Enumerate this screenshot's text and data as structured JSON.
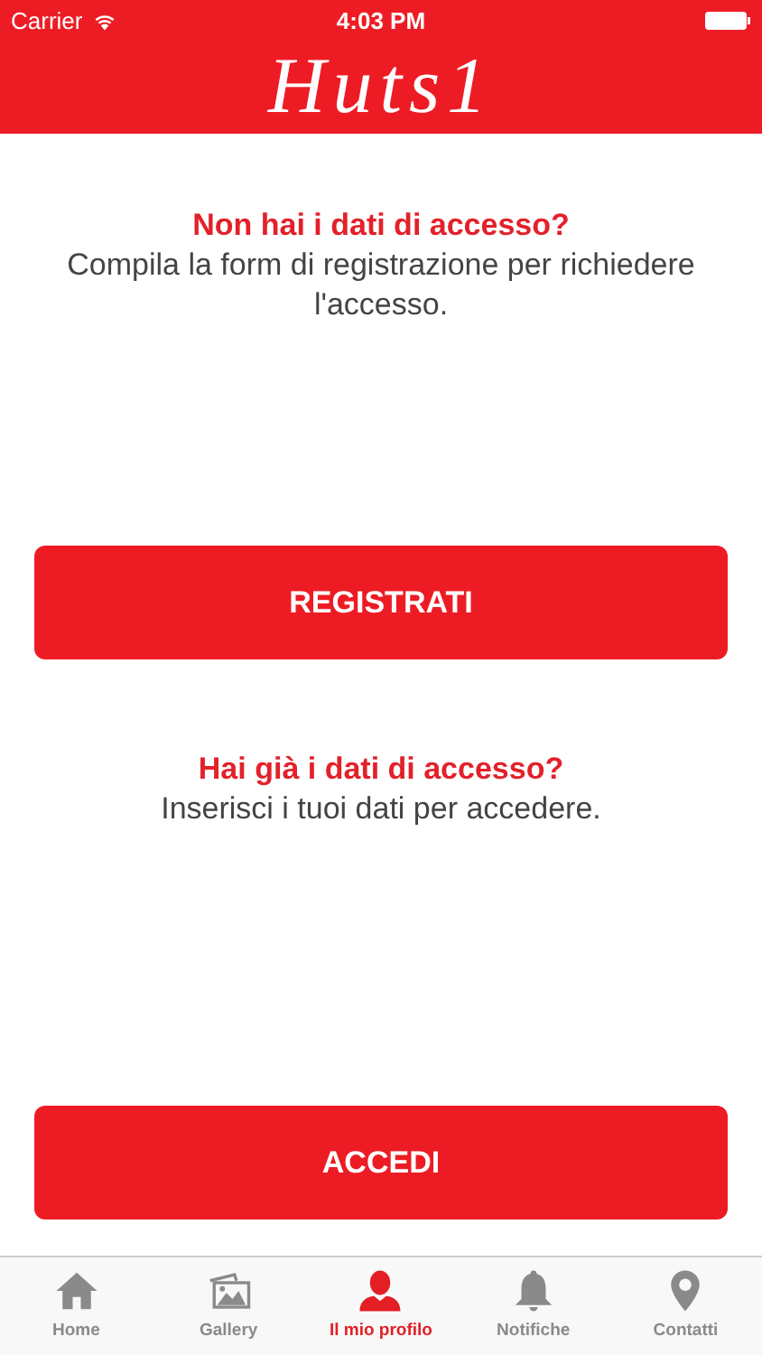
{
  "status_bar": {
    "carrier": "Carrier",
    "time": "4:03 PM"
  },
  "header": {
    "logo": "Huts1"
  },
  "sections": [
    {
      "title": "Non hai i dati di accesso?",
      "text": "Compila la form di registrazione per richiedere l'accesso.",
      "button": "REGISTRATI"
    },
    {
      "title": "Hai già i dati di accesso?",
      "text": "Inserisci i tuoi dati per accedere.",
      "button": "ACCEDI"
    }
  ],
  "tabs": [
    {
      "kind": "home",
      "label": "Home",
      "selected": false
    },
    {
      "kind": "gallery",
      "label": "Gallery",
      "selected": false
    },
    {
      "kind": "profile",
      "label": "Il mio profilo",
      "selected": true
    },
    {
      "kind": "bell",
      "label": "Notifiche",
      "selected": false
    },
    {
      "kind": "pin",
      "label": "Contatti",
      "selected": false
    }
  ]
}
